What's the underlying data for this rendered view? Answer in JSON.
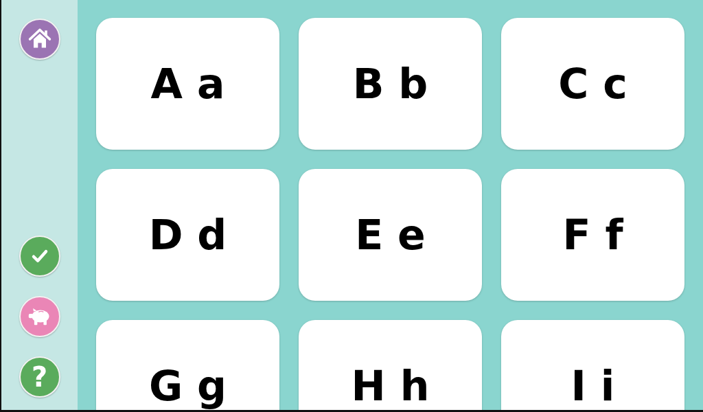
{
  "sidebar": {
    "buttons": [
      {
        "kind": "home"
      },
      {
        "kind": "check"
      },
      {
        "kind": "piggy"
      },
      {
        "kind": "help",
        "label": "?"
      }
    ]
  },
  "cards": [
    {
      "label": "A a"
    },
    {
      "label": "B b"
    },
    {
      "label": "C c"
    },
    {
      "label": "D d"
    },
    {
      "label": "E e"
    },
    {
      "label": "F f"
    },
    {
      "label": "G g"
    },
    {
      "label": "H h"
    },
    {
      "label": "I i"
    }
  ]
}
